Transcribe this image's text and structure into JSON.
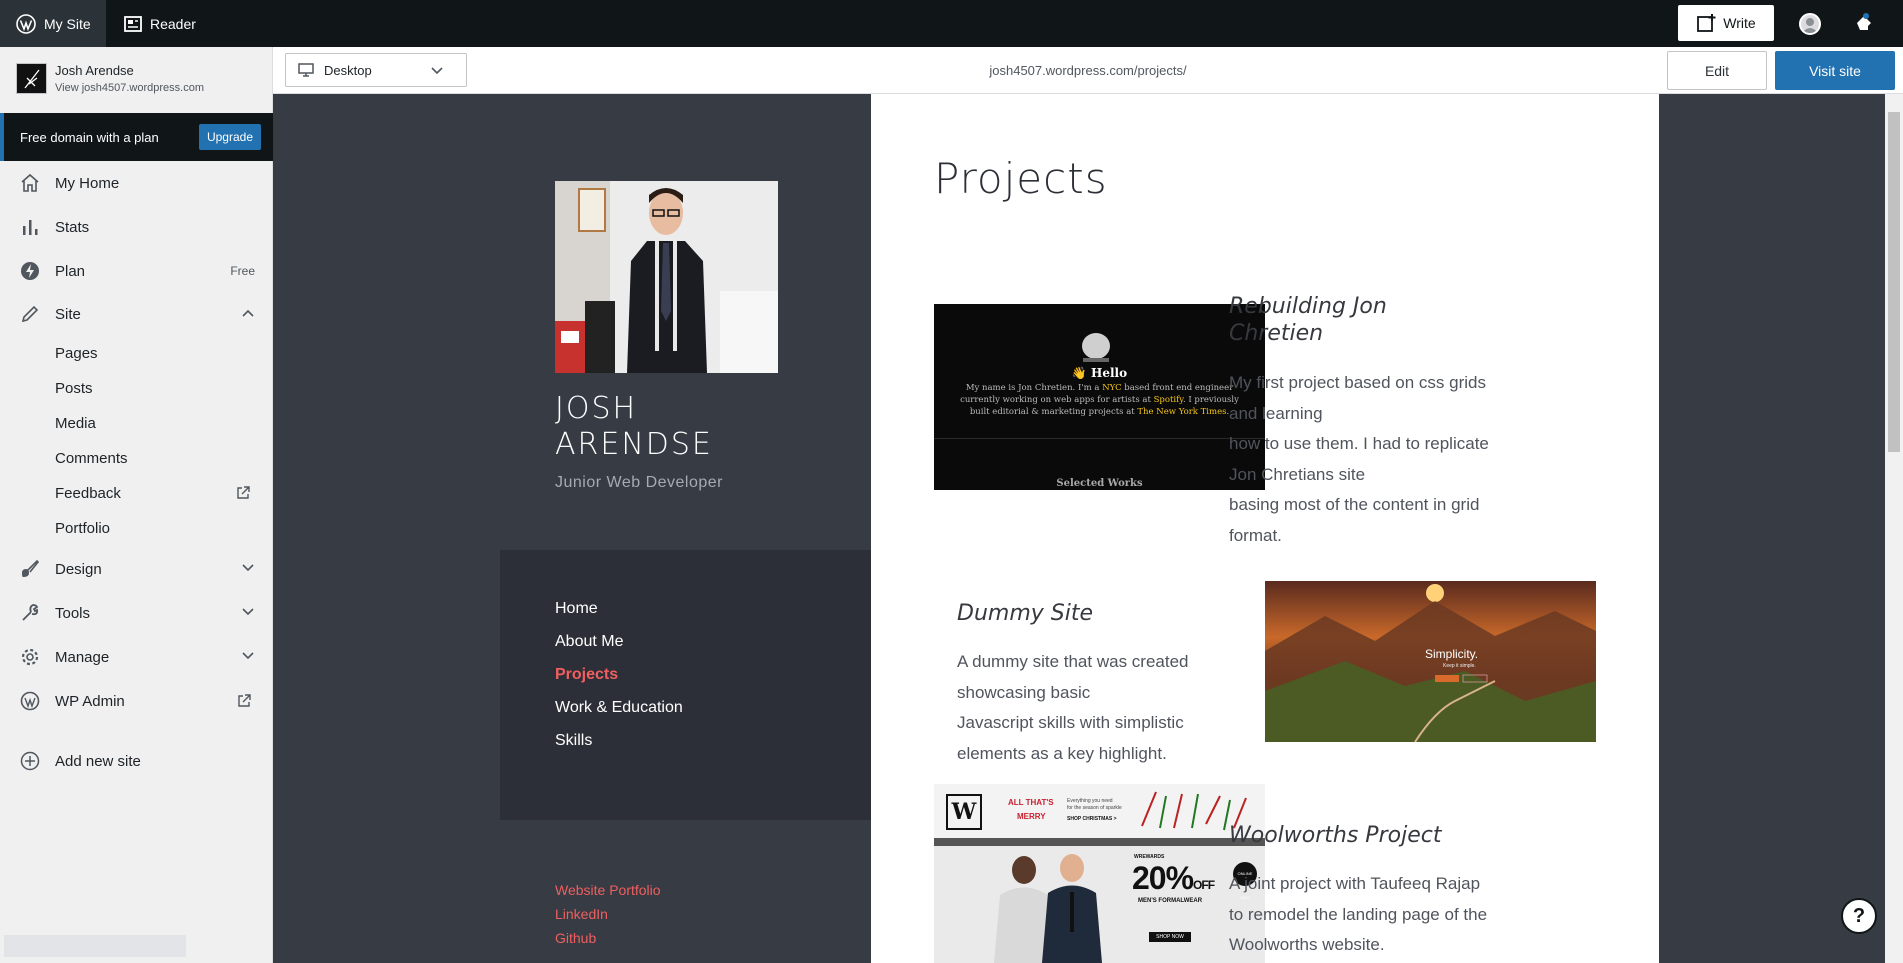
{
  "masterbar": {
    "my_site": "My Site",
    "reader": "Reader",
    "write": "Write"
  },
  "sidebar": {
    "site_name": "Josh Arendse",
    "site_url": "View josh4507.wordpress.com",
    "upsell_text": "Free domain with a plan",
    "upsell_button": "Upgrade",
    "items": [
      {
        "label": "My Home",
        "icon": "home-icon"
      },
      {
        "label": "Stats",
        "icon": "stats-icon"
      },
      {
        "label": "Plan",
        "icon": "plan-icon",
        "badge": "Free"
      },
      {
        "label": "Site",
        "icon": "pencil-icon"
      },
      {
        "label": "Design",
        "icon": "design-icon"
      },
      {
        "label": "Tools",
        "icon": "tools-icon"
      },
      {
        "label": "Manage",
        "icon": "gear-icon"
      },
      {
        "label": "WP Admin",
        "icon": "wordpress-icon"
      },
      {
        "label": "Add new site",
        "icon": "add-icon"
      }
    ],
    "sub_items": [
      "Pages",
      "Posts",
      "Media",
      "Comments",
      "Feedback",
      "Portfolio"
    ]
  },
  "preview": {
    "device": "Desktop",
    "url": "josh4507.wordpress.com/projects/",
    "edit": "Edit",
    "visit": "Visit site"
  },
  "site": {
    "title_line1": "JOSH",
    "title_line2": "ARENDSE",
    "description": "Junior Web Developer",
    "menu": [
      "Home",
      "About Me",
      "Projects",
      "Work & Education",
      "Skills"
    ],
    "social": [
      "Website Portfolio",
      "LinkedIn",
      "Github"
    ],
    "page_title": "Projects",
    "projects": [
      {
        "title": "Rebuilding Jon Chretien",
        "desc": [
          "My first project based on css grids and learning",
          "how to use them. I had to replicate Jon Chretians site",
          "basing most of the content in grid format."
        ],
        "thumb": {
          "hello": "👋 Hello",
          "text_a": "My name is Jon Chretien. I'm a ",
          "nyc": "NYC",
          "text_b": " based front end engineer currently working on web apps for artists at ",
          "spotify": "Spotify",
          "text_c": ". I previously built editorial & marketing projects at ",
          "nyt": "The New York Times",
          "text_d": ".",
          "works": "Selected Works"
        }
      },
      {
        "title": "Dummy Site",
        "desc": [
          "A dummy site that was created showcasing basic",
          "Javascript skills with simplistic elements as a key highlight."
        ],
        "thumb": {
          "word": "Simplicity.",
          "sub": "Keep it simple."
        }
      },
      {
        "title": "Woolworths Project",
        "desc": [
          "A joint project with Taufeeq Rajap",
          "to remodel the landing page of the",
          "Woolworths website."
        ],
        "thumb": {
          "logo": "W",
          "banner1": "ALL THAT'S",
          "banner2": "MERRY",
          "promo1": "Everything you need",
          "promo2": "for the season of sparkle",
          "promo3": "SHOP CHRISTMAS >",
          "rewards": "WREWARDS",
          "discount": "20%",
          "off": "OFF",
          "formal": "MEN'S FORMALWEAR",
          "shop": "SHOP NOW",
          "badge": "ONLINE ONLY"
        }
      }
    ]
  },
  "help": "?"
}
